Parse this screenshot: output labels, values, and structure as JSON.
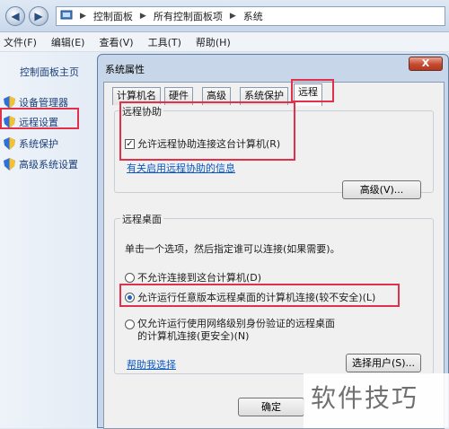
{
  "address_bar": {
    "crumbs": [
      "控制面板",
      "所有控制面板项",
      "系统"
    ]
  },
  "menu": {
    "items": [
      "文件(F)",
      "编辑(E)",
      "查看(V)",
      "工具(T)",
      "帮助(H)"
    ]
  },
  "left_pane": {
    "home": "控制面板主页",
    "links": [
      "设备管理器",
      "远程设置",
      "系统保护",
      "高级系统设置"
    ]
  },
  "dialog": {
    "title": "系统属性",
    "close_label": "X",
    "tabs": [
      "计算机名",
      "硬件",
      "高级",
      "系统保护",
      "远程"
    ],
    "active_tab": "远程",
    "remote_assistance": {
      "group_title": "远程协助",
      "checkbox_label": "允许远程协助连接这台计算机(R)",
      "checked": true,
      "info_link": "有关启用远程协助的信息",
      "advanced_button": "高级(V)..."
    },
    "remote_desktop": {
      "group_title": "远程桌面",
      "instruction": "单击一个选项，然后指定谁可以连接(如果需要)。",
      "options": [
        "不允许连接到这台计算机(D)",
        "允许运行任意版本远程桌面的计算机连接(较不安全)(L)",
        "仅允许运行使用网络级别身份验证的远程桌面的计算机连接(更安全)(N)"
      ],
      "selected_index": 1,
      "help_link": "帮助我选择",
      "select_users_button": "选择用户(S)..."
    },
    "ok_button": "确定"
  },
  "watermark": "软件技巧",
  "colors": {
    "highlight": "#e0304a",
    "link": "#0b57c2",
    "radio_dot": "#1e63c9"
  }
}
